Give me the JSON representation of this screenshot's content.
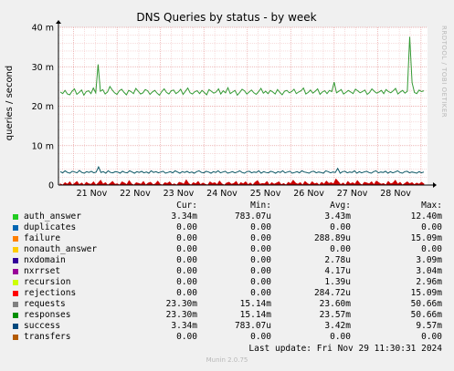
{
  "chart_data": {
    "type": "line",
    "title": "DNS Queries by status - by week",
    "ylabel": "queries / second",
    "side_text": "RRDTOOL / TOBI OETIKER",
    "ylim": [
      0,
      0.04
    ],
    "y_ticks": [
      {
        "value": 0,
        "label": "0"
      },
      {
        "value": 0.01,
        "label": "10 m"
      },
      {
        "value": 0.02,
        "label": "20 m"
      },
      {
        "value": 0.03,
        "label": "30 m"
      },
      {
        "value": 0.04,
        "label": "40 m"
      }
    ],
    "x_ticks": [
      "21 Nov",
      "22 Nov",
      "23 Nov",
      "24 Nov",
      "25 Nov",
      "26 Nov",
      "27 Nov",
      "28 Nov"
    ],
    "grid": true,
    "series": [
      {
        "name": "requests",
        "color": "#339933",
        "draw": "line",
        "values": [
          23.6,
          23.2,
          24.0,
          23.1,
          22.9,
          23.8,
          24.4,
          23.0,
          23.5,
          24.1,
          22.8,
          23.7,
          23.9,
          23.2,
          24.6,
          23.4,
          30.6,
          23.8,
          24.2,
          23.1,
          23.6,
          25.0,
          24.1,
          23.4,
          23.0,
          23.9,
          24.3,
          23.5,
          22.9,
          24.0,
          23.7,
          23.2,
          24.5,
          23.8,
          23.1,
          23.4,
          24.2,
          23.9,
          23.0,
          23.6,
          24.0,
          23.3,
          22.8,
          23.7,
          24.4,
          23.5,
          23.1,
          23.9,
          24.1,
          23.2,
          23.6,
          24.3,
          23.0,
          23.8,
          24.6,
          23.4,
          23.1,
          23.7,
          23.9,
          23.2,
          24.0,
          23.5,
          22.9,
          24.2,
          23.8,
          23.3,
          23.6,
          24.4,
          23.1,
          23.9,
          23.4,
          24.7,
          23.2,
          23.6,
          24.0,
          22.8,
          23.5,
          24.3,
          23.9,
          23.1,
          23.6,
          24.1,
          23.4,
          23.0,
          23.7,
          24.5,
          23.3,
          23.8,
          23.2,
          24.0,
          23.6,
          23.1,
          24.2,
          23.5,
          22.9,
          23.8,
          24.0,
          23.4,
          23.7,
          24.3,
          23.2,
          23.6,
          23.9,
          24.6,
          23.1,
          23.5,
          24.1,
          23.3,
          23.8,
          24.4,
          23.0,
          23.6,
          23.9,
          23.2,
          24.0,
          23.7,
          26.1,
          23.4,
          23.8,
          24.2,
          23.1,
          23.5,
          24.0,
          23.6,
          23.2,
          24.3,
          23.9,
          23.4,
          23.7,
          24.1,
          23.0,
          23.5,
          24.4,
          23.8,
          23.3,
          23.6,
          24.0,
          23.2,
          24.2,
          23.7,
          23.4,
          23.9,
          24.5,
          23.1,
          23.6,
          24.0,
          23.3,
          23.8,
          37.6,
          26.0,
          23.5,
          23.2,
          24.1,
          23.7,
          23.9
        ]
      },
      {
        "name": "success",
        "color": "#0b5563",
        "draw": "line",
        "values": [
          3.4,
          3.1,
          3.6,
          3.2,
          3.0,
          3.5,
          3.3,
          3.1,
          3.7,
          3.2,
          3.0,
          3.4,
          3.2,
          3.5,
          3.1,
          3.3,
          4.6,
          3.2,
          3.4,
          3.0,
          3.6,
          3.2,
          3.1,
          3.4,
          3.3,
          3.0,
          3.5,
          3.2,
          3.1,
          3.6,
          3.3,
          3.0,
          3.4,
          3.2,
          3.5,
          3.1,
          3.3,
          3.0,
          3.6,
          3.2,
          3.4,
          3.1,
          3.3,
          3.5,
          3.0,
          3.2,
          3.4,
          3.1,
          3.6,
          3.3,
          3.0,
          3.4,
          3.2,
          3.5,
          3.1,
          3.3,
          3.0,
          3.4,
          3.6,
          3.2,
          3.1,
          3.5,
          3.3,
          3.0,
          3.4,
          3.2,
          3.6,
          3.1,
          3.3,
          3.5,
          3.0,
          3.2,
          3.4,
          3.1,
          3.3,
          3.6,
          3.2,
          3.0,
          3.4,
          3.5,
          3.1,
          3.3,
          3.2,
          3.6,
          3.0,
          3.4,
          3.2,
          3.1,
          3.5,
          3.3,
          3.0,
          3.4,
          3.2,
          3.6,
          3.1,
          3.3,
          3.5,
          3.0,
          3.2,
          3.4,
          3.1,
          3.6,
          3.3,
          3.2,
          3.0,
          3.4,
          3.5,
          3.1,
          3.3,
          3.2,
          3.0,
          3.6,
          3.4,
          3.1,
          3.3,
          3.2,
          4.2,
          3.0,
          3.4,
          3.5,
          3.1,
          3.3,
          3.2,
          3.6,
          3.0,
          3.4,
          3.1,
          3.3,
          3.5,
          3.2,
          3.0,
          3.4,
          3.6,
          3.1,
          3.3,
          3.2,
          3.5,
          3.0,
          3.4,
          3.1,
          3.3,
          3.6,
          3.2,
          3.0,
          3.4,
          3.5,
          3.1,
          3.3,
          3.2,
          3.0,
          3.4,
          3.1,
          3.3
        ]
      },
      {
        "name": "rejections",
        "color": "#cc0000",
        "draw": "area",
        "values": [
          0.3,
          0,
          0.6,
          0.2,
          0.8,
          0,
          0.4,
          0.9,
          0.1,
          0.5,
          0,
          0.7,
          0.3,
          0.2,
          0.8,
          0,
          0.5,
          1.2,
          0.2,
          0.6,
          0,
          0.4,
          0.9,
          0.2,
          0.3,
          0,
          0.8,
          0.5,
          0.1,
          1.1,
          0.3,
          0,
          0.6,
          0.4,
          0.2,
          0.9,
          0,
          0.5,
          0.7,
          0.1,
          0.3,
          1.0,
          0.2,
          0,
          0.6,
          0.4,
          0.8,
          0.1,
          0.3,
          0,
          0.7,
          0.5,
          0.2,
          1.3,
          0.4,
          0,
          0.6,
          0.3,
          0.9,
          0.1,
          0.5,
          0.2,
          0,
          0.8,
          0.4,
          0.6,
          0.1,
          1.0,
          0.3,
          0,
          0.5,
          0.7,
          0.2,
          0.4,
          0.9,
          0,
          0.6,
          0.3,
          0.8,
          0.1,
          0.5,
          0,
          0.7,
          1.1,
          0.2,
          0.4,
          0.3,
          0.9,
          0,
          0.6,
          0.2,
          0.5,
          0.8,
          0.1,
          0.4,
          0,
          0.7,
          0.3,
          1.2,
          0.5,
          0.2,
          0.6,
          0,
          0.9,
          0.4,
          0.1,
          0.8,
          0.3,
          0.5,
          0,
          0.7,
          0.2,
          1.0,
          0.4,
          0.6,
          0.3,
          1.5,
          0.8,
          0.1,
          0.5,
          0,
          0.9,
          0.3,
          0.6,
          0.2,
          1.1,
          0.4,
          0,
          0.7,
          0.5,
          0.3,
          0.8,
          0.1,
          1.0,
          0.6,
          0.2,
          0.4,
          0,
          0.9,
          0.3,
          0.5,
          1.2,
          0.2,
          0.7,
          0,
          0.4,
          0.8,
          0.3,
          0.6,
          0.1,
          0.5,
          0.2,
          0.7,
          0.3
        ]
      }
    ]
  },
  "legend": {
    "headers": {
      "cur": "Cur:",
      "min": "Min:",
      "avg": "Avg:",
      "max": "Max:"
    },
    "rows": [
      {
        "name": "auth_answer",
        "color": "#22cc22",
        "cur": "3.34m",
        "min": "783.07u",
        "avg": "3.43m",
        "max": "12.40m"
      },
      {
        "name": "duplicates",
        "color": "#0066b3",
        "cur": "0.00",
        "min": "0.00",
        "avg": "0.00",
        "max": "0.00"
      },
      {
        "name": "failure",
        "color": "#ff8000",
        "cur": "0.00",
        "min": "0.00",
        "avg": "288.89u",
        "max": "15.09m"
      },
      {
        "name": "nonauth_answer",
        "color": "#ffcc00",
        "cur": "0.00",
        "min": "0.00",
        "avg": "0.00",
        "max": "0.00"
      },
      {
        "name": "nxdomain",
        "color": "#330099",
        "cur": "0.00",
        "min": "0.00",
        "avg": "2.78u",
        "max": "3.09m"
      },
      {
        "name": "nxrrset",
        "color": "#990099",
        "cur": "0.00",
        "min": "0.00",
        "avg": "4.17u",
        "max": "3.04m"
      },
      {
        "name": "recursion",
        "color": "#ccff00",
        "cur": "0.00",
        "min": "0.00",
        "avg": "1.39u",
        "max": "2.96m"
      },
      {
        "name": "rejections",
        "color": "#ff0000",
        "cur": "0.00",
        "min": "0.00",
        "avg": "284.72u",
        "max": "15.09m"
      },
      {
        "name": "requests",
        "color": "#808080",
        "cur": "23.30m",
        "min": "15.14m",
        "avg": "23.60m",
        "max": "50.66m"
      },
      {
        "name": "responses",
        "color": "#008f00",
        "cur": "23.30m",
        "min": "15.14m",
        "avg": "23.57m",
        "max": "50.66m"
      },
      {
        "name": "success",
        "color": "#00487d",
        "cur": "3.34m",
        "min": "783.07u",
        "avg": "3.42m",
        "max": "9.57m"
      },
      {
        "name": "transfers",
        "color": "#b35a00",
        "cur": "0.00",
        "min": "0.00",
        "avg": "0.00",
        "max": "0.00"
      }
    ]
  },
  "last_update": "Last update: Fri Nov 29 11:30:31 2024",
  "footer": "Munin 2.0.75"
}
